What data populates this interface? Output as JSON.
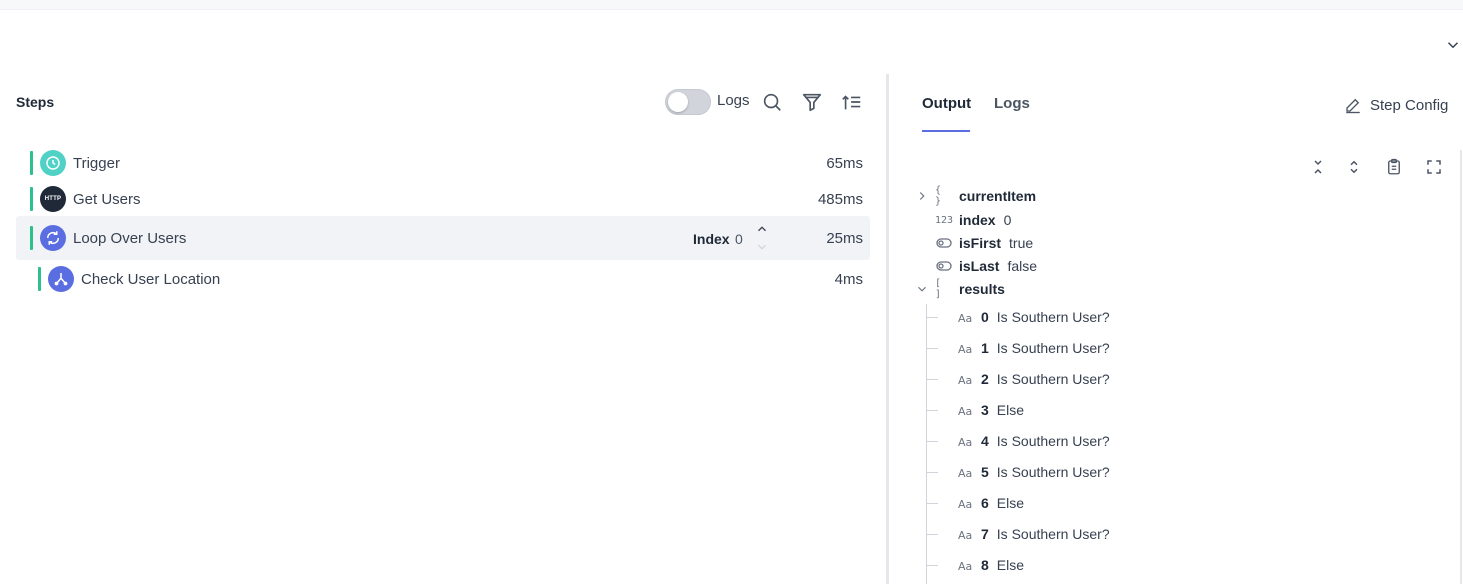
{
  "steps_panel": {
    "title": "Steps",
    "logs_toggle_label": "Logs",
    "logs_toggle_on": false,
    "icons": [
      "search-icon",
      "filter-icon",
      "sort-icon"
    ],
    "steps": [
      {
        "name": "Trigger",
        "duration": "65ms",
        "icon": "clock-icon",
        "status_color": "#2ec08c"
      },
      {
        "name": "Get Users",
        "duration": "485ms",
        "icon": "http-icon",
        "icon_text": "HTTP",
        "status_color": "#2ec08c"
      },
      {
        "name": "Loop Over Users",
        "duration": "25ms",
        "icon": "loop-icon",
        "status_color": "#2ec08c",
        "selected": true,
        "index_label": "Index",
        "index_value": "0"
      },
      {
        "name": "Check User Location",
        "duration": "4ms",
        "icon": "branch-icon",
        "status_color": "#2ec08c",
        "nested": true
      }
    ]
  },
  "output_panel": {
    "tabs": [
      {
        "label": "Output",
        "active": true
      },
      {
        "label": "Logs",
        "active": false
      }
    ],
    "step_config_label": "Step Config",
    "toolbar_icons": [
      "collapse-all-icon",
      "expand-all-icon",
      "clipboard-icon",
      "fullscreen-icon"
    ],
    "tree": {
      "currentItem": {
        "key": "currentItem",
        "type": "object",
        "expanded": false
      },
      "index": {
        "key": "index",
        "value": "0",
        "type_glyph": "123"
      },
      "isFirst": {
        "key": "isFirst",
        "value": "true"
      },
      "isLast": {
        "key": "isLast",
        "value": "false"
      },
      "results": {
        "key": "results",
        "type": "array",
        "expanded": true,
        "items": [
          {
            "index": "0",
            "value": "Is Southern User?"
          },
          {
            "index": "1",
            "value": "Is Southern User?"
          },
          {
            "index": "2",
            "value": "Is Southern User?"
          },
          {
            "index": "3",
            "value": "Else"
          },
          {
            "index": "4",
            "value": "Is Southern User?"
          },
          {
            "index": "5",
            "value": "Is Southern User?"
          },
          {
            "index": "6",
            "value": "Else"
          },
          {
            "index": "7",
            "value": "Is Southern User?"
          },
          {
            "index": "8",
            "value": "Else"
          }
        ]
      }
    }
  },
  "colors": {
    "accent": "#5b6ee1",
    "success": "#2ec08c",
    "trigger_teal": "#4fd1c5",
    "loop_blue": "#5b6ee1"
  }
}
